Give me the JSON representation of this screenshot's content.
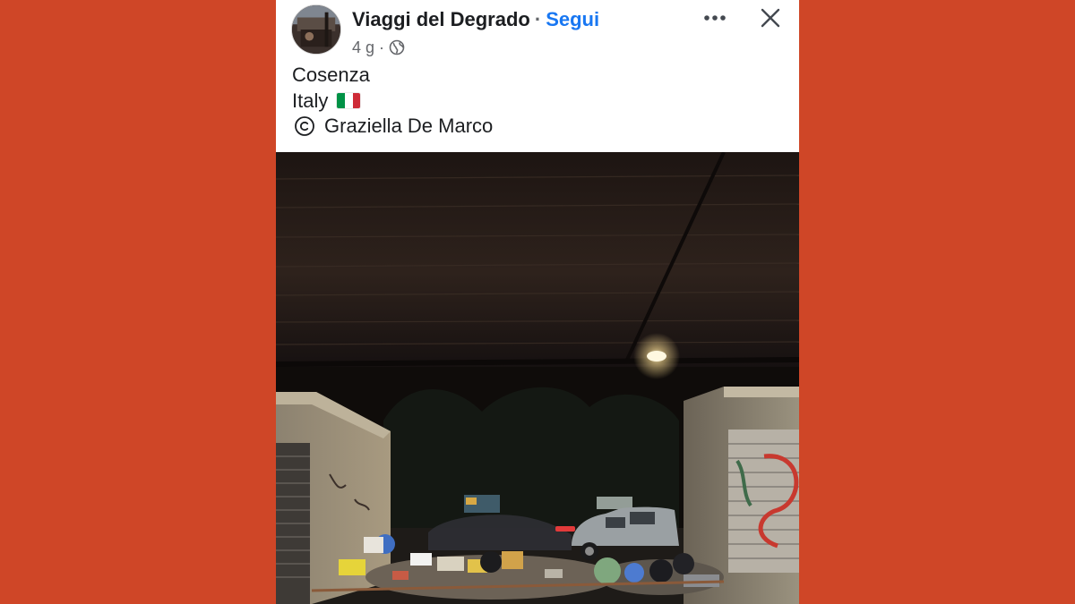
{
  "post": {
    "page_name": "Viaggi del Degrado",
    "separator": "·",
    "follow_label": "Segui",
    "time_ago": "4 g",
    "meta_separator": "·",
    "visibility_icon": "globe-icon",
    "more_icon": "more-horizontal-icon",
    "close_icon": "close-icon",
    "text": {
      "line1": "Cosenza",
      "line2": "Italy",
      "line2_flag": "italy-flag-icon",
      "line3_symbol_icon": "copyright-icon",
      "line3": "Graziella De Marco"
    },
    "photo": {
      "subject": "night street under overpass with trash piles and dumpsters"
    }
  },
  "colors": {
    "background": "#cf4627",
    "card": "#ffffff",
    "link_blue": "#1877f2",
    "primary_text": "#1c1e21",
    "secondary_text": "#65676b"
  }
}
